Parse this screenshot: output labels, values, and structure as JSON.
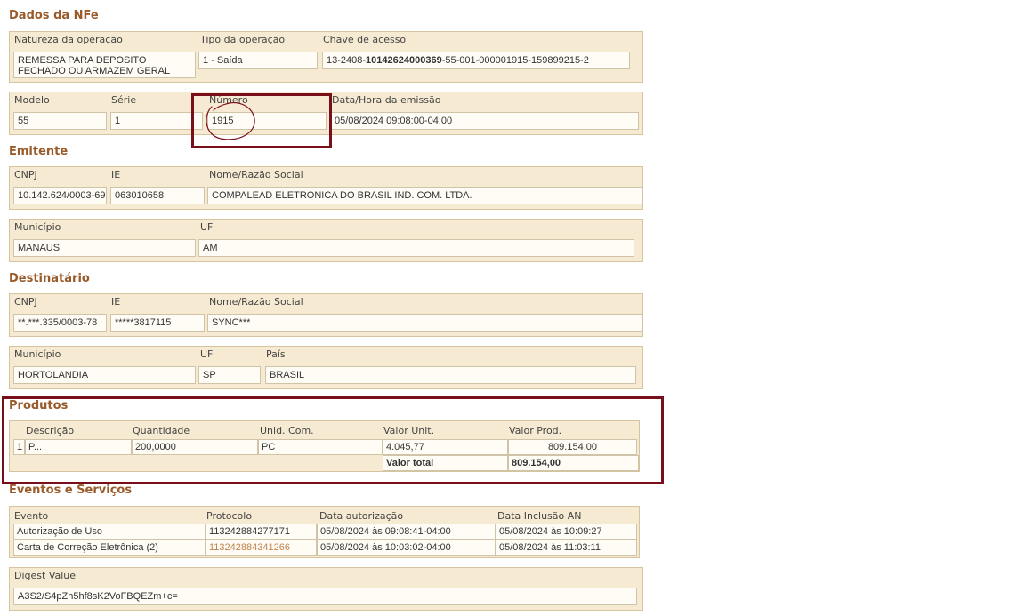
{
  "dados_nfe": {
    "title": "Dados da NFe",
    "natureza_label": "Natureza da operação",
    "natureza_value": "REMESSA PARA DEPOSITO FECHADO OU ARMAZEM GERAL",
    "tipo_label": "Tipo da operação",
    "tipo_value": "1 - Saída",
    "chave_label": "Chave de acesso",
    "chave_prefix": "13-2408-",
    "chave_bold": "10142624000369",
    "chave_suffix": "-55-001-000001915-159899215-2",
    "modelo_label": "Modelo",
    "modelo_value": "55",
    "serie_label": "Série",
    "serie_value": "1",
    "numero_label": "Número",
    "numero_value": "1915",
    "data_label": "Data/Hora da emissão",
    "data_value": "05/08/2024 09:08:00-04:00"
  },
  "emitente": {
    "title": "Emitente",
    "cnpj_label": "CNPJ",
    "cnpj_value": "10.142.624/0003-69",
    "ie_label": "IE",
    "ie_value": "063010658",
    "nome_label": "Nome/Razão Social",
    "nome_value": "COMPALEAD ELETRONICA DO BRASIL IND. COM. LTDA.",
    "municipio_label": "Município",
    "municipio_value": "MANAUS",
    "uf_label": "UF",
    "uf_value": "AM"
  },
  "destinatario": {
    "title": "Destinatário",
    "cnpj_label": "CNPJ",
    "cnpj_value": "**.***.335/0003-78",
    "ie_label": "IE",
    "ie_value": "*****3817115",
    "nome_label": "Nome/Razão Social",
    "nome_value": "SYNC***",
    "municipio_label": "Município",
    "municipio_value": "HORTOLANDIA",
    "uf_label": "UF",
    "uf_value": "SP",
    "pais_label": "País",
    "pais_value": "BRASIL"
  },
  "produtos": {
    "title": "Produtos",
    "headers": [
      "Descrição",
      "Quantidade",
      "Unid. Com.",
      "Valor Unit.",
      "Valor Prod."
    ],
    "row": {
      "num": "1",
      "descricao": "P...",
      "quantidade": "200,0000",
      "unidade": "PC",
      "valor_unit": "4.045,77",
      "valor_prod": "809.154,00"
    },
    "total_label": "Valor total",
    "total_value": "809.154,00"
  },
  "eventos": {
    "title": "Eventos e Serviços",
    "headers": [
      "Evento",
      "Protocolo",
      "Data autorização",
      "Data Inclusão AN"
    ],
    "rows": [
      {
        "evento": "Autorização de Uso",
        "protocolo": "113242884277171",
        "data_aut": "05/08/2024 às 09:08:41-04:00",
        "data_an": "05/08/2024 às 10:09:27"
      },
      {
        "evento": "Carta de Correção Eletrônica (2)",
        "protocolo": "113242884341266",
        "data_aut": "05/08/2024 às 10:03:02-04:00",
        "data_an": "05/08/2024 às 11:03:11"
      }
    ],
    "digest_label": "Digest Value",
    "digest_value": "A3S2/S4pZh5hf8sK2VoFBQEZm+c="
  },
  "annotations": {
    "color": "#7a0f1c"
  }
}
